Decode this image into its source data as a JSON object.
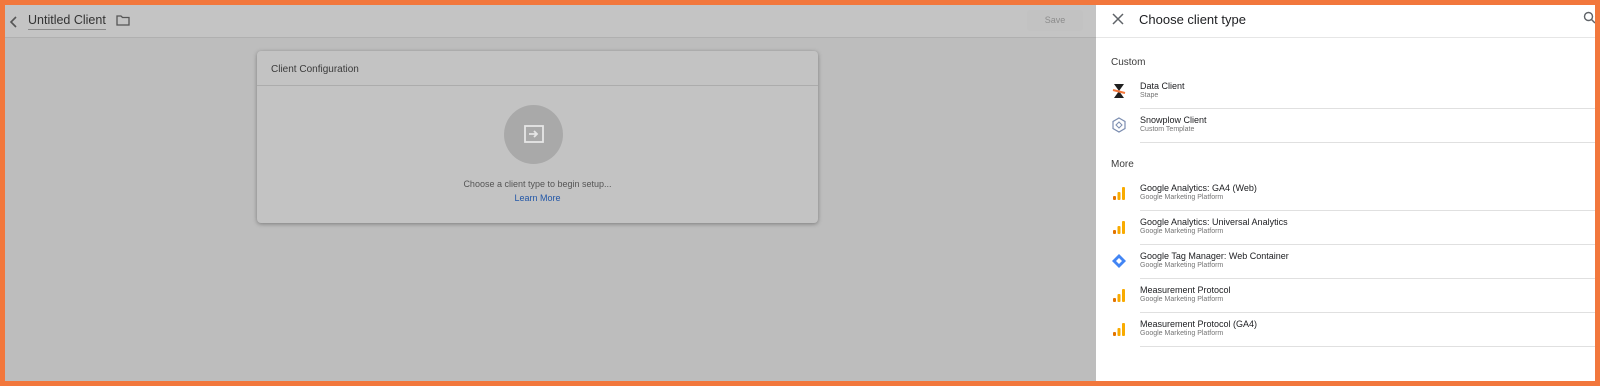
{
  "editor": {
    "title": "Untitled Client",
    "save_label": "Save",
    "card": {
      "title": "Client Configuration",
      "hint": "Choose a client type to begin setup...",
      "link": "Learn More"
    }
  },
  "panel": {
    "title": "Choose client type",
    "sections": {
      "custom_label": "Custom",
      "more_label": "More"
    },
    "custom_items": [
      {
        "name": "Data Client",
        "sub": "Stape",
        "icon": "stape-logo-icon"
      },
      {
        "name": "Snowplow Client",
        "sub": "Custom Template",
        "icon": "snowplow-logo-icon"
      }
    ],
    "more_items": [
      {
        "name": "Google Analytics: GA4 (Web)",
        "sub": "Google Marketing Platform",
        "icon": "google-analytics-icon"
      },
      {
        "name": "Google Analytics: Universal Analytics",
        "sub": "Google Marketing Platform",
        "icon": "google-analytics-icon"
      },
      {
        "name": "Google Tag Manager: Web Container",
        "sub": "Google Marketing Platform",
        "icon": "google-tag-manager-icon"
      },
      {
        "name": "Measurement Protocol",
        "sub": "Google Marketing Platform",
        "icon": "google-analytics-icon"
      },
      {
        "name": "Measurement Protocol (GA4)",
        "sub": "Google Marketing Platform",
        "icon": "google-analytics-icon"
      }
    ]
  },
  "colors": {
    "frame_border": "#f2773c",
    "overlay_gray": "#bdbdbd",
    "link_blue": "#2257a8",
    "analytics_orange": "#f9ab00",
    "gtm_blue": "#4285f4"
  }
}
